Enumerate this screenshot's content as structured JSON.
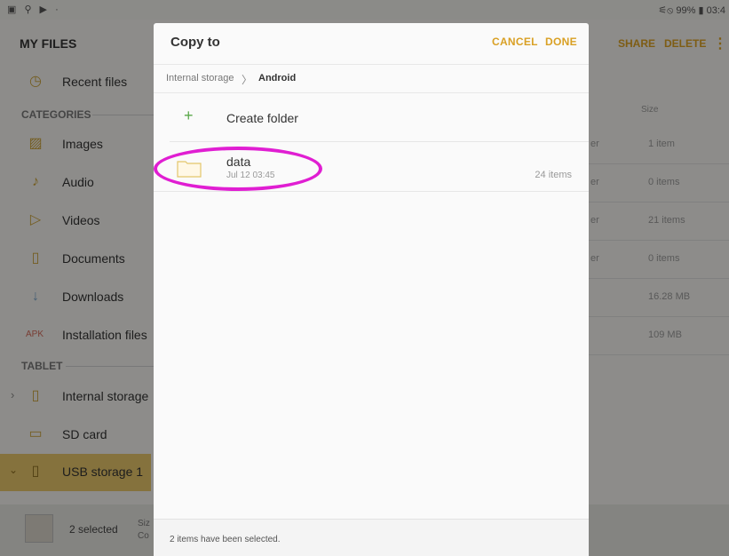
{
  "status_bar": {
    "left_icons": "▣ ⚲ ▶ ·",
    "right_text": "⚟⦸ 99% ▮ 03:4"
  },
  "app": {
    "title": "MY FILES",
    "actions": {
      "share": "SHARE",
      "delete": "DELETE",
      "more": "⋮"
    }
  },
  "sidebar": {
    "recent": {
      "label": "Recent files",
      "icon": "clock-icon"
    },
    "categories_header": "CATEGORIES",
    "categories": [
      {
        "label": "Images",
        "icon": "image-icon"
      },
      {
        "label": "Audio",
        "icon": "music-icon"
      },
      {
        "label": "Videos",
        "icon": "video-icon"
      },
      {
        "label": "Documents",
        "icon": "document-icon"
      },
      {
        "label": "Downloads",
        "icon": "download-icon"
      },
      {
        "label": "Installation files",
        "icon": "apk-icon",
        "icon_text": "APK"
      }
    ],
    "tablet_header": "TABLET",
    "tablet": [
      {
        "label": "Internal storage",
        "icon": "phone-icon"
      },
      {
        "label": "SD card",
        "icon": "sdcard-icon"
      },
      {
        "label": "USB storage 1",
        "icon": "usb-icon"
      }
    ]
  },
  "background_list": {
    "size_header": "Size",
    "rows": [
      {
        "frag": "er",
        "size": "1 item"
      },
      {
        "frag": "er",
        "size": "0 items"
      },
      {
        "frag": "er",
        "size": "21 items"
      },
      {
        "frag": "er",
        "size": "0 items"
      },
      {
        "frag": "",
        "size": "16.28 MB"
      },
      {
        "frag": "",
        "size": "109 MB"
      }
    ]
  },
  "bottom_bar": {
    "selected": "2 selected",
    "frag1": "Siz",
    "frag2": "Co"
  },
  "dialog": {
    "title": "Copy to",
    "cancel": "CANCEL",
    "done": "DONE",
    "breadcrumb": {
      "root": "Internal storage",
      "sep": "〉",
      "current": "Android"
    },
    "create_folder": {
      "plus": "+",
      "label": "Create folder"
    },
    "folders": [
      {
        "name": "data",
        "date": "Jul 12 03:45",
        "count": "24 items"
      }
    ],
    "footer": "2 items have been selected."
  },
  "colors": {
    "accent": "#d9a024",
    "highlight": "#e01ed2",
    "usb_selected": "#e6c46a",
    "create_plus": "#5aa84a"
  }
}
